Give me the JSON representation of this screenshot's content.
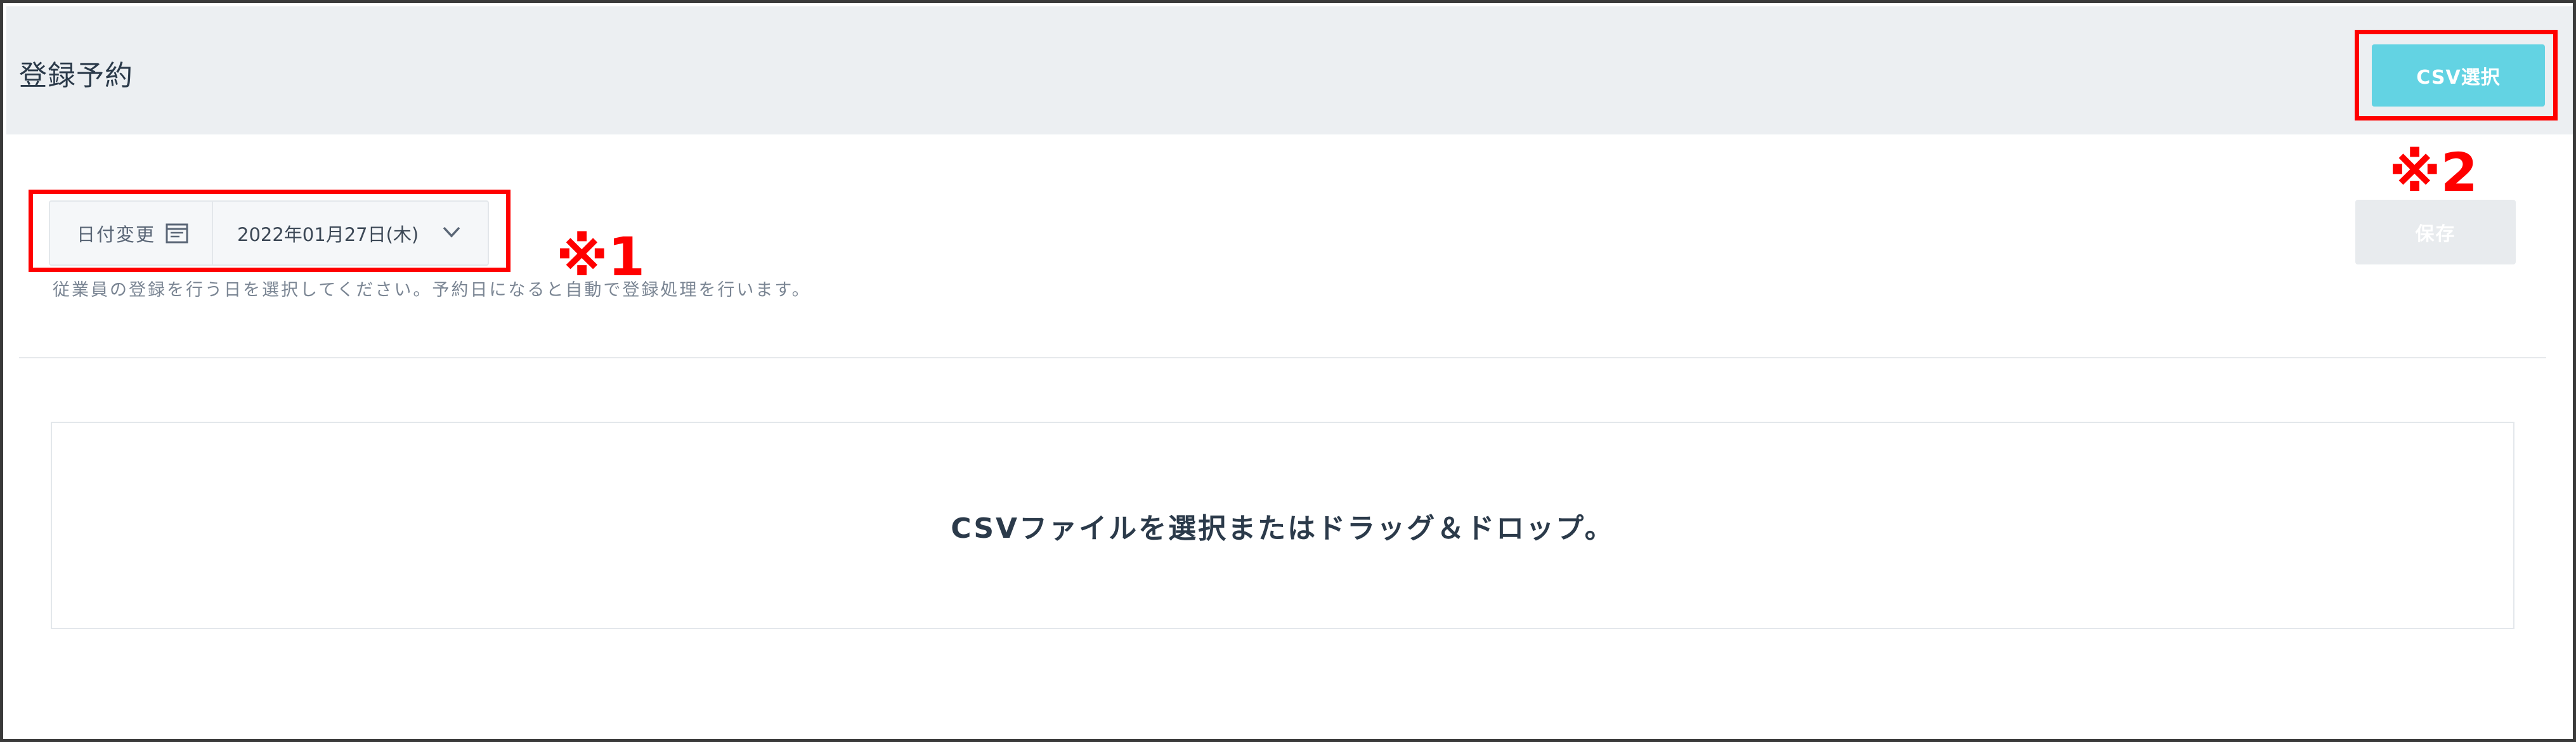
{
  "header": {
    "title": "登録予約",
    "csv_select_label": "CSV選択"
  },
  "date_picker": {
    "label": "日付変更",
    "value": "2022年01月27日(木)",
    "calendar_icon": "calendar-icon",
    "chevron_icon": "chevron-down-icon"
  },
  "helper_text": "従業員の登録を行う日を選択してください。予約日になると自動で登録処理を行います。",
  "save_label": "保存",
  "dropzone": {
    "text": "CSVファイルを選択またはドラッグ＆ドロップ。"
  },
  "annotations": [
    {
      "label": "※1"
    },
    {
      "label": "※2"
    }
  ],
  "colors": {
    "header_bg": "#eceff2",
    "csv_button_bg": "#63d3e3",
    "save_button_bg": "#e8ebee",
    "annotation": "#ff0000"
  }
}
